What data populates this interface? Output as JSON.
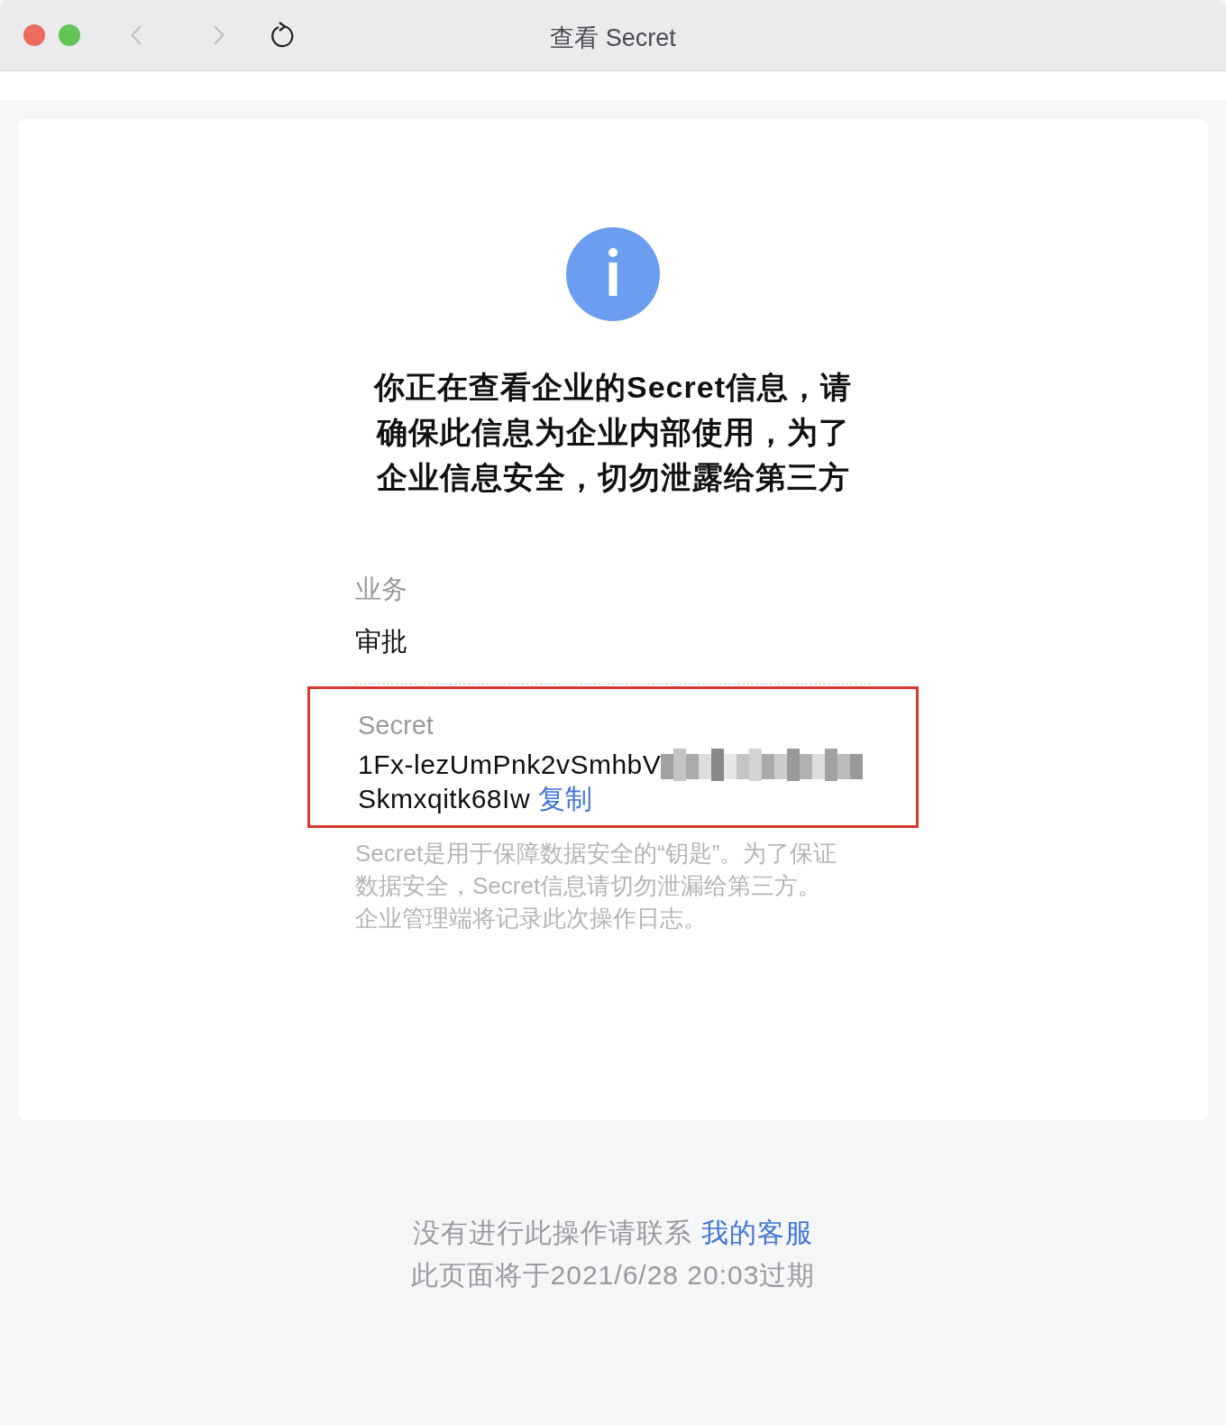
{
  "window": {
    "title": "查看 Secret",
    "back": {
      "disabled": true
    },
    "forward": {
      "disabled": true
    }
  },
  "notice": {
    "heading": "你正在查看企业的Secret信息，请确保此信息为企业内部使用，为了企业信息安全，切勿泄露给第三方"
  },
  "fields": [
    {
      "label": "业务",
      "value": "审批"
    }
  ],
  "secret": {
    "label": "Secret",
    "value_start": "1Fx-lezUmPnk2vSmhbV",
    "value_end": "Skmxqitk68Iw",
    "copy_link": "复制",
    "highlighted": true
  },
  "hint": [
    "Secret是用于保障数据安全的“钥匙”。为了保证",
    "数据安全，Secret信息请切勿泄漏给第三方。",
    "企业管理端将记录此次操作日志。"
  ],
  "footer": {
    "contact_text": "没有进行此操作请联系",
    "contact_link": "我的客服",
    "expiry": "此页面将于2021/6/28 20:03过期"
  }
}
